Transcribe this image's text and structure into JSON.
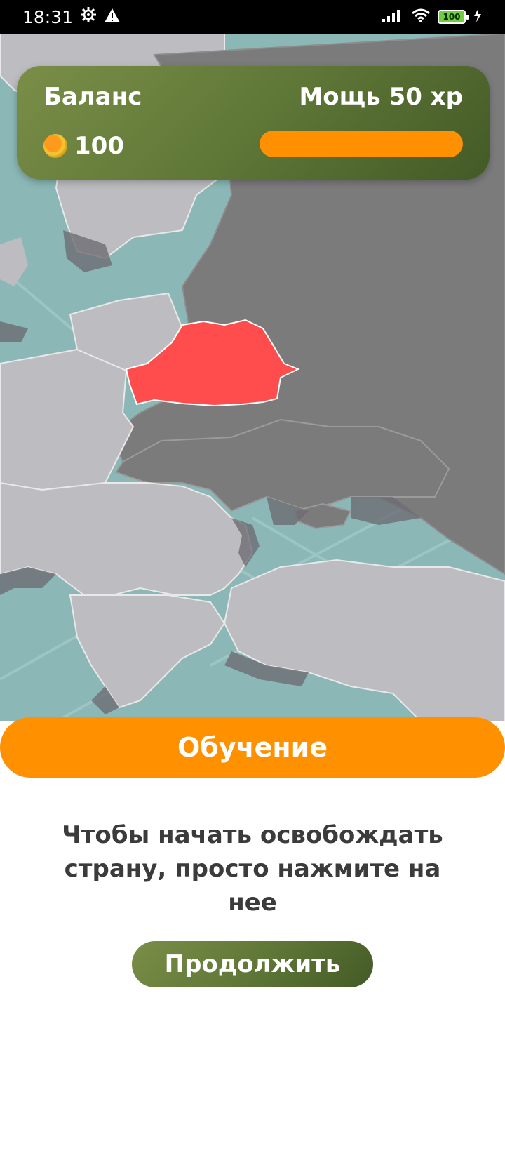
{
  "status_bar": {
    "time": "18:31",
    "battery_level": "100",
    "icons": [
      "settings-icon",
      "warning-icon",
      "signal-icon",
      "wifi-icon",
      "battery-icon",
      "charging-icon"
    ]
  },
  "hud": {
    "balance_label": "Баланс",
    "balance_value": "100",
    "power_label": "Мощь 50 xp",
    "power_bar_fill": 1.0,
    "power_bar_color": "#ff9100"
  },
  "map": {
    "highlighted_country_color": "#ff4d4d",
    "land_color": "#bdbcc1",
    "territory_color": "#7c7b7c",
    "sea_color": "#8bb8b6"
  },
  "tutorial": {
    "title": "Обучение",
    "text": "Чтобы начать освобождать страну, просто нажмите на нее",
    "continue_label": "Продолжить"
  },
  "colors": {
    "accent_orange": "#ff9100",
    "hud_green": "#5f7737",
    "text_dark": "#3b3b3b"
  }
}
